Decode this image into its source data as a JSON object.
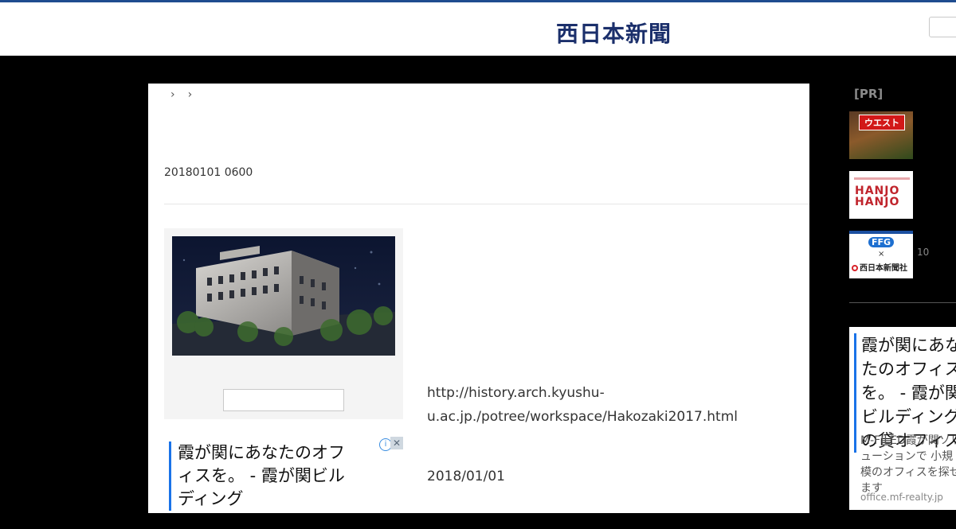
{
  "header": {
    "logo": "西日本新聞",
    "search_value": ""
  },
  "breadcrumb": {
    "separators": [
      "›",
      "›"
    ]
  },
  "article": {
    "timestamp_raw": "20180101 0600",
    "photo": {
      "alt": "point cloud scan of historic building",
      "caption_value": ""
    },
    "url_text": "http://history.arch.kyushu-u.ac.jp./potree/workspace/Hakozaki2017.html",
    "date": "2018/01/01"
  },
  "ad_left": {
    "headline": "霞が関にあなたのオフィスを。 - 霞が関ビルディング"
  },
  "sidebar": {
    "pr_label": "[PR]",
    "thumbs": [
      {
        "badge": "ウエスト"
      },
      {
        "logo_text": "HANJO HANJO"
      },
      {
        "ffg": "FFG",
        "x": "×",
        "company": "西日本新聞社"
      }
    ],
    "count": "10"
  },
  "ad_right": {
    "headline": "霞が関にあなたのオフィスを。 - 霞が関ビルディングの貸オフィス",
    "description": "M-FILED霞が関ソリューションで 小規模のオフィスを探せます",
    "url": "office.mf-realty.jp"
  }
}
